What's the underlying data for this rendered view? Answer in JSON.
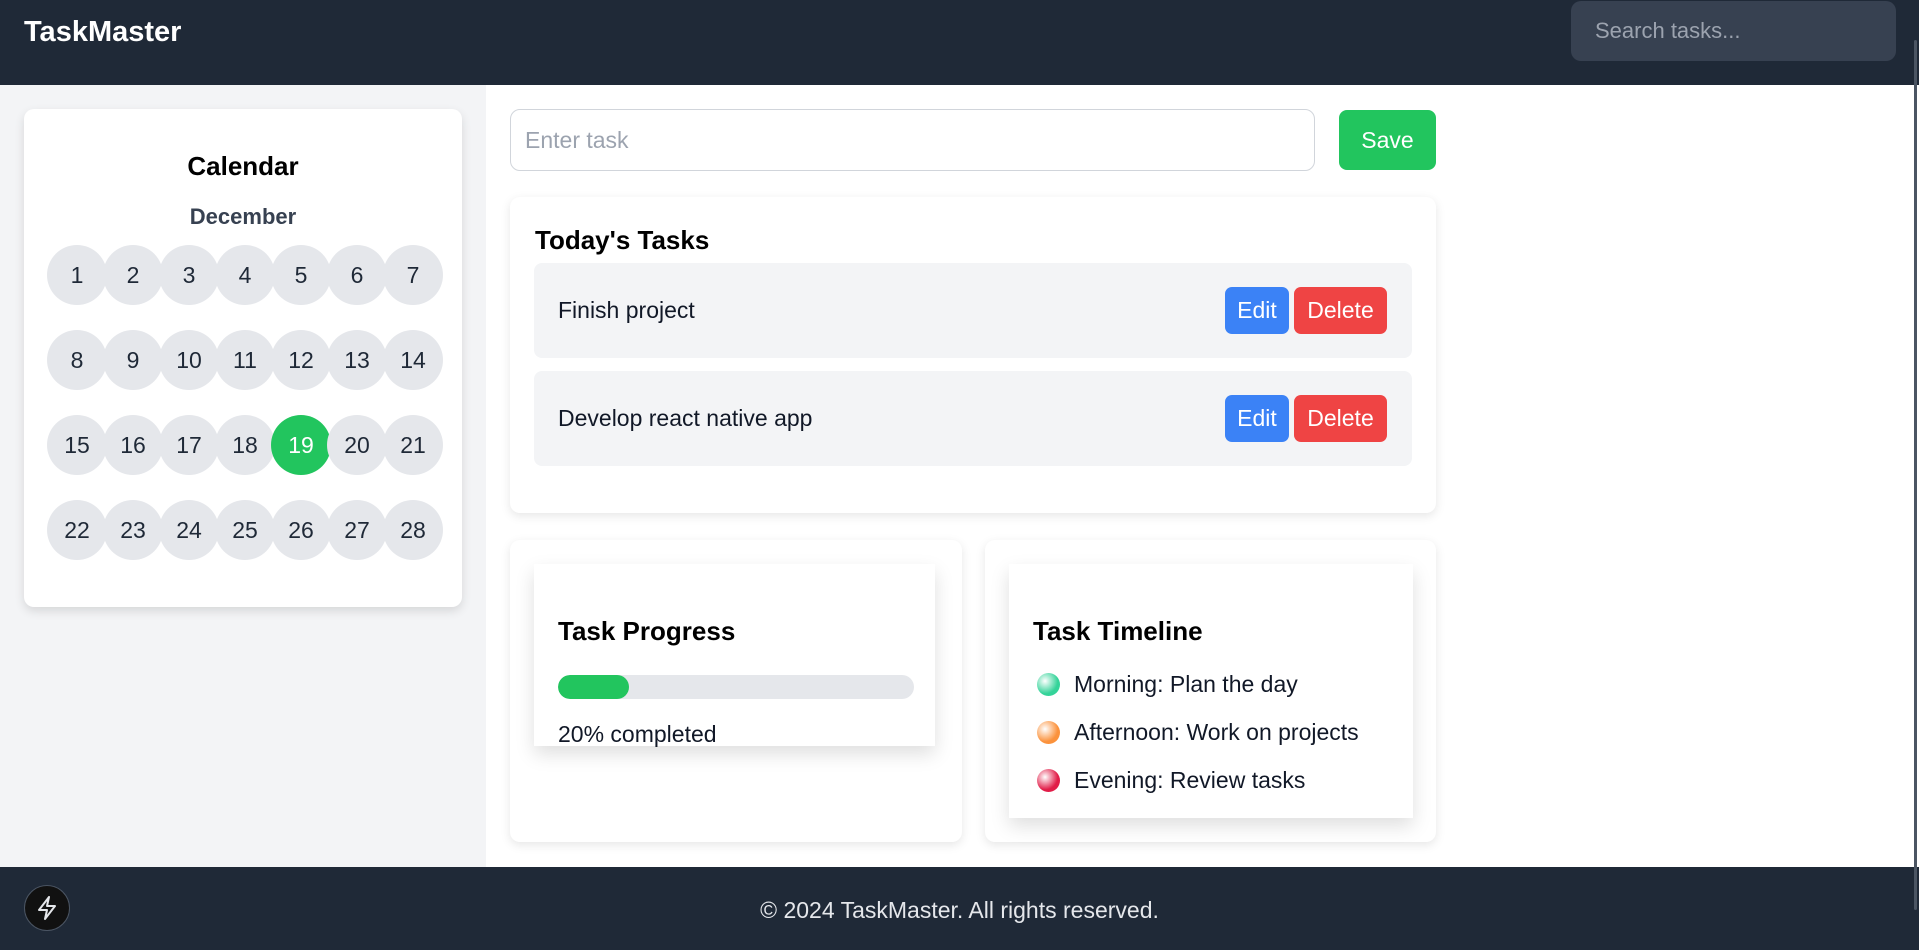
{
  "header": {
    "brand": "TaskMaster",
    "search_placeholder": "Search tasks..."
  },
  "calendar": {
    "title": "Calendar",
    "month": "December",
    "selected_day": "19",
    "days": [
      "1",
      "2",
      "3",
      "4",
      "5",
      "6",
      "7",
      "8",
      "9",
      "10",
      "11",
      "12",
      "13",
      "14",
      "15",
      "16",
      "17",
      "18",
      "19",
      "20",
      "21",
      "22",
      "23",
      "24",
      "25",
      "26",
      "27",
      "28"
    ]
  },
  "task_input": {
    "placeholder": "Enter task",
    "value": "",
    "save_label": "Save"
  },
  "today": {
    "title": "Today's Tasks",
    "tasks": [
      {
        "text": "Finish project",
        "edit_label": "Edit",
        "delete_label": "Delete"
      },
      {
        "text": "Develop react native app",
        "edit_label": "Edit",
        "delete_label": "Delete"
      }
    ]
  },
  "progress": {
    "title": "Task Progress",
    "percent": 20,
    "label": "20% completed"
  },
  "timeline": {
    "title": "Task Timeline",
    "items": [
      {
        "text": "Morning: Plan the day",
        "color": "#34d399"
      },
      {
        "text": "Afternoon: Work on projects",
        "color": "#fb923c"
      },
      {
        "text": "Evening: Review tasks",
        "color": "#e11d48"
      }
    ]
  },
  "footer": {
    "text": "© 2024 TaskMaster. All rights reserved.",
    "bolt_icon": "lightning-bolt-icon"
  },
  "colors": {
    "header_bg": "#1f2937",
    "accent_green": "#22c55e",
    "edit_blue": "#3b82f6",
    "delete_red": "#ef4444"
  }
}
